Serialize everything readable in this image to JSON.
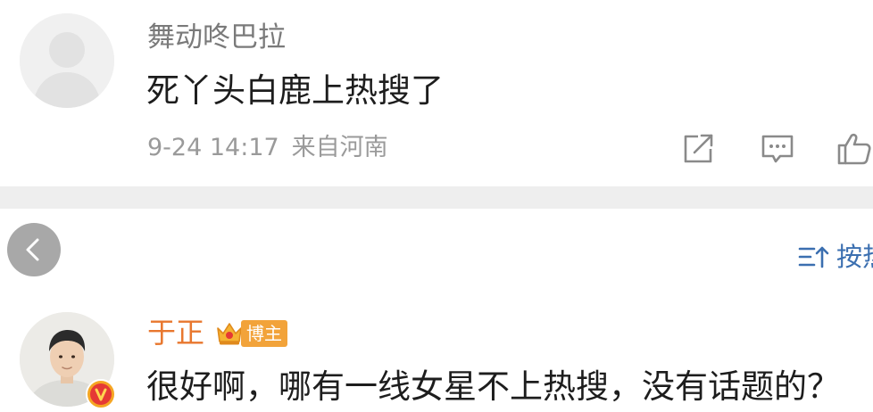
{
  "comments": [
    {
      "username": "舞动咚巴拉",
      "text": "死丫头白鹿上热搜了",
      "date": "9-24 14:17",
      "location": "来自河南"
    },
    {
      "username": "于正",
      "badge": "博主",
      "text": "很好啊，哪有一线女星不上热搜，没有话题的？"
    }
  ],
  "sort": {
    "label": "按热"
  },
  "colors": {
    "username_primary": "#7a7a7a",
    "username_vip": "#e8772e",
    "badge_bg": "#f2a33a",
    "sort_link": "#3b6fb0",
    "meta_text": "#9a9a9a",
    "divider_band": "#eeeeee"
  },
  "icons": {
    "share": "share-icon",
    "comment": "comment-icon",
    "like": "thumbs-up-icon",
    "back": "chevron-left-icon",
    "sort": "sort-icon",
    "crown": "crown-icon",
    "verified": "verified-v-icon"
  }
}
